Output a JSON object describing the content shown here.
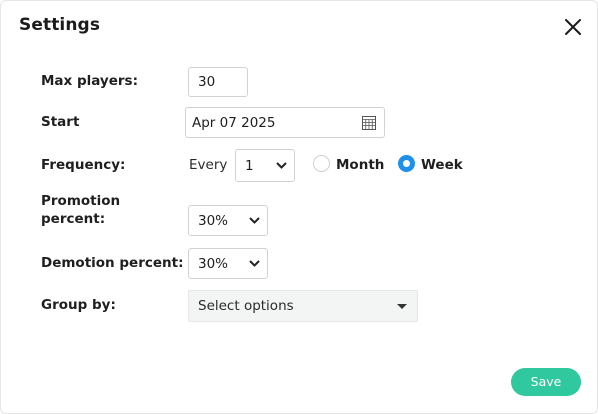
{
  "dialog": {
    "title": "Settings",
    "close_icon": "close-icon"
  },
  "form": {
    "max_players": {
      "label": "Max players:",
      "value": "30"
    },
    "start": {
      "label": "Start",
      "value": "Apr 07 2025",
      "icon": "calendar-icon"
    },
    "frequency": {
      "label": "Frequency:",
      "every_text": "Every",
      "every_value": "1",
      "options": [
        {
          "label": "Month",
          "selected": false
        },
        {
          "label": "Week",
          "selected": true
        }
      ]
    },
    "promotion": {
      "label_line1": "Promotion",
      "label_line2": "percent:",
      "value": "30%"
    },
    "demotion": {
      "label": "Demotion percent:",
      "value": "30%"
    },
    "group_by": {
      "label": "Group by:",
      "placeholder": "Select options"
    }
  },
  "footer": {
    "save_label": "Save"
  },
  "colors": {
    "accent": "#30c89e",
    "radio_selected": "#1e90e8"
  }
}
